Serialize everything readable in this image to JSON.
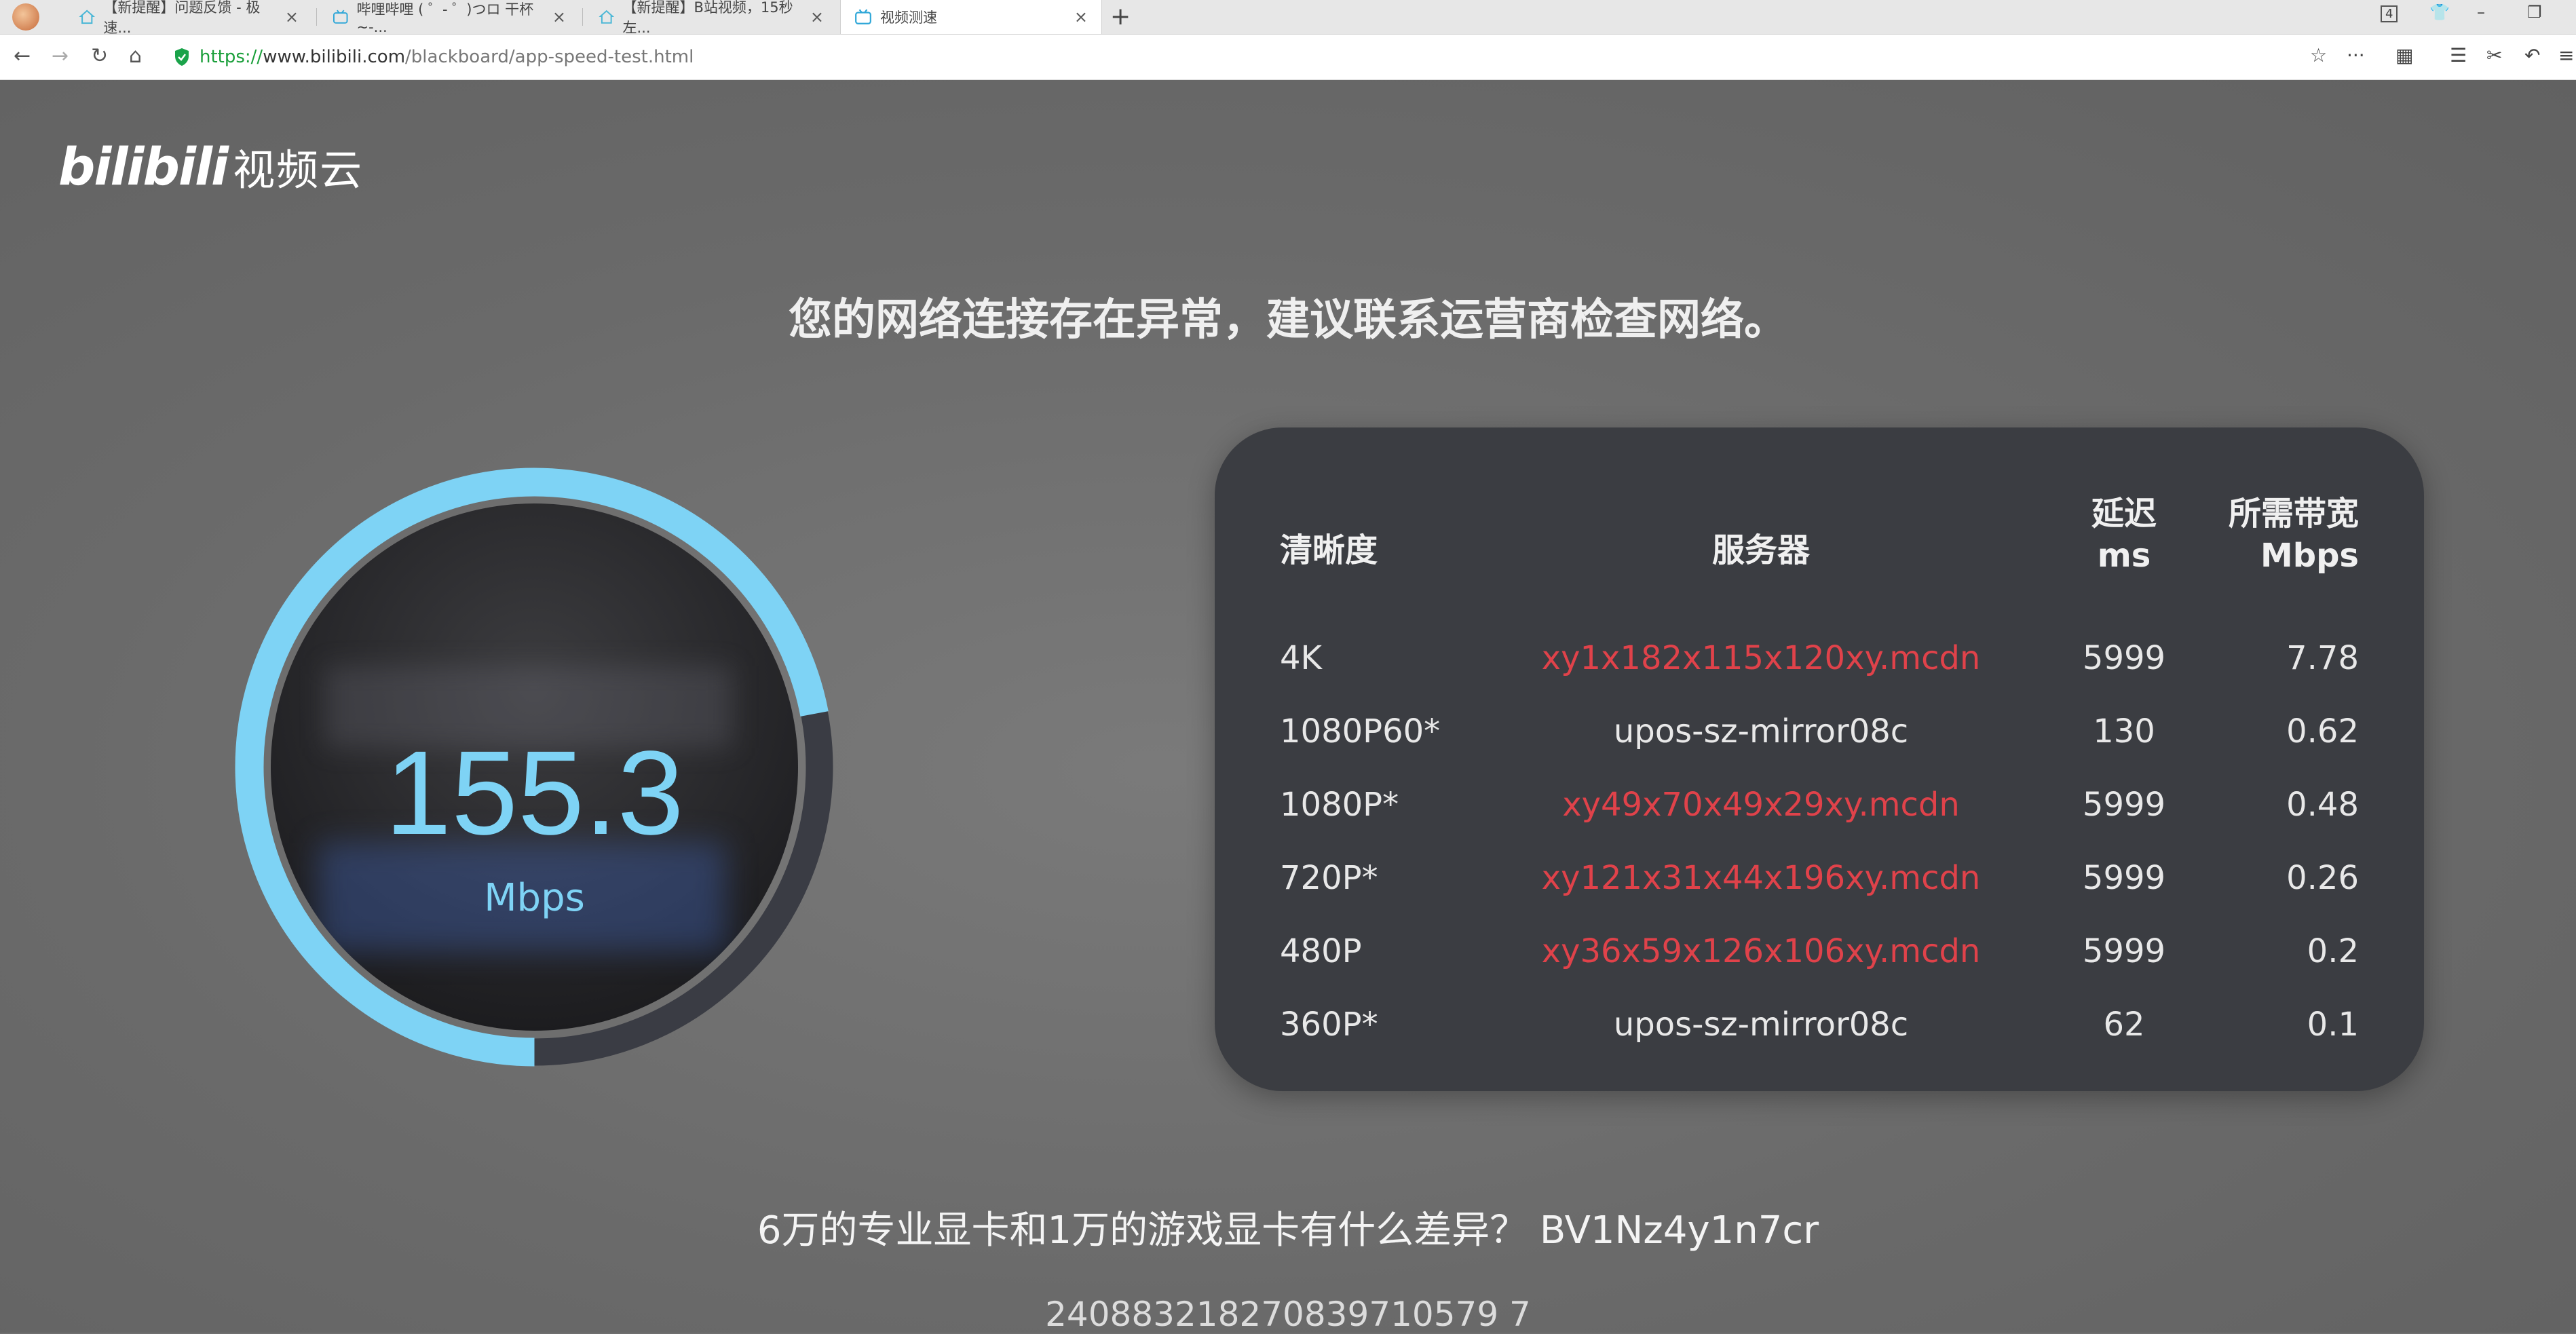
{
  "browser": {
    "tabs": [
      {
        "label": "【新提醒】问题反馈 - 极速..."
      },
      {
        "label": "哔哩哔哩 ( ゜- ゜)つロ 干杯~-..."
      },
      {
        "label": "【新提醒】B站视频，15秒左..."
      },
      {
        "label": "视频测速"
      }
    ],
    "new_tab": "+",
    "tab_count": "4",
    "url": {
      "protocol": "https://",
      "domain": "www.bilibili.com",
      "path": "/blackboard/app-speed-test.html"
    },
    "menu_dots": "···"
  },
  "logo": {
    "brand": "bilibili",
    "suffix": "视频云"
  },
  "headline": "您的网络连接存在异常，建议联系运营商检查网络。",
  "gauge": {
    "value": "155.3",
    "unit": "Mbps",
    "fraction": 0.72
  },
  "table": {
    "headers": {
      "quality": "清晰度",
      "server": "服务器",
      "latency": "延迟",
      "latency_unit": "ms",
      "bandwidth": "所需带宽",
      "bandwidth_unit": "Mbps"
    },
    "rows": [
      {
        "quality": "4K",
        "server": "xy1x182x115x120xy.mcdn",
        "latency": "5999",
        "bandwidth": "7.78"
      },
      {
        "quality": "1080P60*",
        "server": "upos-sz-mirror08c",
        "latency": "130",
        "bandwidth": "0.62"
      },
      {
        "quality": "1080P*",
        "server": "xy49x70x49x29xy.mcdn",
        "latency": "5999",
        "bandwidth": "0.48"
      },
      {
        "quality": "720P*",
        "server": "xy121x31x44x196xy.mcdn",
        "latency": "5999",
        "bandwidth": "0.26"
      },
      {
        "quality": "480P",
        "server": "xy36x59x126x106xy.mcdn",
        "latency": "5999",
        "bandwidth": "0.2"
      },
      {
        "quality": "360P*",
        "server": "upos-sz-mirror08c",
        "latency": "62",
        "bandwidth": "0.1"
      }
    ]
  },
  "colors": {
    "accent": "#7ed3f5",
    "error_server": "#e0424a",
    "panel": "#3b3d42",
    "track": "#3a3c44"
  },
  "video": {
    "title": "6万的专业显卡和1万的游戏显卡有什么差异？  BV1Nz4y1n7cr",
    "id": "240883218270839710579 7"
  }
}
